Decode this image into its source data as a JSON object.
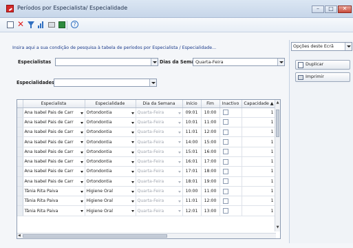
{
  "window": {
    "title": "Períodos por Especialista/ Especialidade",
    "buttons": {
      "minimize": "–",
      "maximize": "□",
      "close": "✕"
    }
  },
  "toolbar": {
    "icons": [
      "new-document-icon",
      "delete-icon",
      "filter-icon",
      "chart-icon",
      "print-icon",
      "excel-export-icon",
      "help-icon"
    ],
    "delete_glyph": "✕",
    "help_glyph": "?"
  },
  "filters": {
    "hint": "Insira aqui a sua condição de pesquisa à tabela de períodos por Especialista / Especialidade...",
    "especialistas_label": "Especialistas",
    "especialistas_value": "",
    "dias_label": "Dias da Semana",
    "dias_value": "Quarta-Feira",
    "especialidades_label": "Especialidades",
    "especialidades_value": ""
  },
  "grid": {
    "columns": [
      "Especialista",
      "Especialidade",
      "Dia da Semana",
      "Início",
      "Fim",
      "Inactivo",
      "Capacidade"
    ],
    "sort_glyph": "▲",
    "rows": [
      {
        "especialista": "Ana Isabel Pais de Carr",
        "especialidade": "Ortondontia",
        "dia": "Quarta-Feira",
        "inicio": "09:01",
        "fim": "10:00",
        "capacidade": "1"
      },
      {
        "especialista": "Ana Isabel Pais de Carr",
        "especialidade": "Ortondontia",
        "dia": "Quarta-Feira",
        "inicio": "10:01",
        "fim": "11:00",
        "capacidade": "1"
      },
      {
        "especialista": "Ana Isabel Pais de Carr",
        "especialidade": "Ortondontia",
        "dia": "Quarta-Feira",
        "inicio": "11:01",
        "fim": "12:00",
        "capacidade": "1"
      },
      {
        "especialista": "Ana Isabel Pais de Carr",
        "especialidade": "Ortondontia",
        "dia": "Quarta-Feira",
        "inicio": "14:00",
        "fim": "15:00",
        "capacidade": "1"
      },
      {
        "especialista": "Ana Isabel Pais de Carr",
        "especialidade": "Ortondontia",
        "dia": "Quarta-Feira",
        "inicio": "15:01",
        "fim": "16:00",
        "capacidade": "1"
      },
      {
        "especialista": "Ana Isabel Pais de Carr",
        "especialidade": "Ortondontia",
        "dia": "Quarta-Feira",
        "inicio": "16:01",
        "fim": "17:00",
        "capacidade": "1"
      },
      {
        "especialista": "Ana Isabel Pais de Carr",
        "especialidade": "Ortondontia",
        "dia": "Quarta-Feira",
        "inicio": "17:01",
        "fim": "18:00",
        "capacidade": "1"
      },
      {
        "especialista": "Ana Isabel Pais de Carr",
        "especialidade": "Ortondontia",
        "dia": "Quarta-Feira",
        "inicio": "18:01",
        "fim": "19:00",
        "capacidade": "1"
      },
      {
        "especialista": "Tânia Rita Paiva",
        "especialidade": "Higiene Oral",
        "dia": "Quarta-Feira",
        "inicio": "10:00",
        "fim": "11:00",
        "capacidade": "1"
      },
      {
        "especialista": "Tânia Rita Paiva",
        "especialidade": "Higiene Oral",
        "dia": "Quarta-Feira",
        "inicio": "11:01",
        "fim": "12:00",
        "capacidade": "1"
      },
      {
        "especialista": "Tânia Rita Paiva",
        "especialidade": "Higiene Oral",
        "dia": "Quarta-Feira",
        "inicio": "12:01",
        "fim": "13:00",
        "capacidade": "1"
      }
    ]
  },
  "side_panel": {
    "options_label": "Opções deste Ecrã",
    "duplicate_label": "Duplicar",
    "print_label": "Imprimir"
  }
}
